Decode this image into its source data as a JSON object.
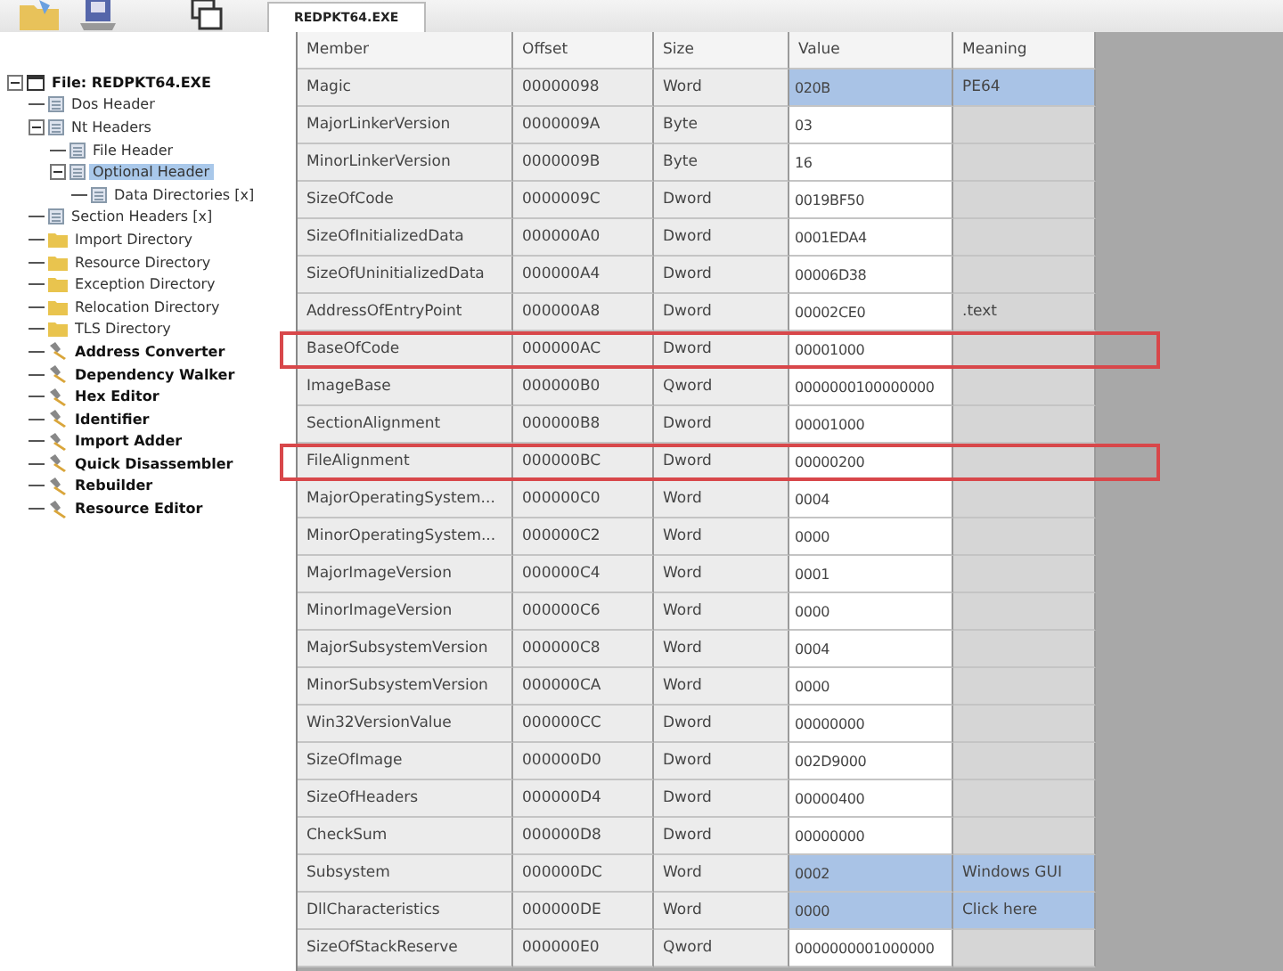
{
  "tab": {
    "label": "REDPKT64.EXE",
    "selected": true
  },
  "tree": [
    {
      "label": "File: REDPKT64.EXE",
      "kind": "file",
      "expanded": true,
      "selected": false,
      "children": [
        {
          "label": "Dos Header",
          "kind": "page",
          "selected": false
        },
        {
          "label": "Nt Headers",
          "kind": "page",
          "expanded": true,
          "selected": false,
          "children": [
            {
              "label": "File Header",
              "kind": "page",
              "selected": false
            },
            {
              "label": "Optional Header",
              "kind": "page",
              "expanded": true,
              "selected": true,
              "children": [
                {
                  "label": "Data Directories [x]",
                  "kind": "page",
                  "selected": false
                }
              ]
            }
          ]
        },
        {
          "label": "Section Headers [x]",
          "kind": "page",
          "selected": false
        },
        {
          "label": "Import Directory",
          "kind": "folder",
          "selected": false
        },
        {
          "label": "Resource Directory",
          "kind": "folder",
          "selected": false
        },
        {
          "label": "Exception Directory",
          "kind": "folder",
          "selected": false
        },
        {
          "label": "Relocation Directory",
          "kind": "folder",
          "selected": false
        },
        {
          "label": "TLS Directory",
          "kind": "folder",
          "selected": false
        },
        {
          "label": "Address Converter",
          "kind": "tool",
          "selected": false
        },
        {
          "label": "Dependency Walker",
          "kind": "tool",
          "selected": false
        },
        {
          "label": "Hex Editor",
          "kind": "tool",
          "selected": false
        },
        {
          "label": "Identifier",
          "kind": "tool",
          "selected": false
        },
        {
          "label": "Import Adder",
          "kind": "tool",
          "selected": false
        },
        {
          "label": "Quick Disassembler",
          "kind": "tool",
          "selected": false
        },
        {
          "label": "Rebuilder",
          "kind": "tool",
          "selected": false
        },
        {
          "label": "Resource Editor",
          "kind": "tool",
          "selected": false
        }
      ]
    }
  ],
  "table": {
    "columns": [
      "Member",
      "Offset",
      "Size",
      "Value",
      "Meaning"
    ],
    "rows": [
      {
        "cells": [
          "Magic",
          "00000098",
          "Word",
          "020B",
          "PE64"
        ],
        "selected": true,
        "highlighted": false
      },
      {
        "cells": [
          "MajorLinkerVersion",
          "0000009A",
          "Byte",
          "03",
          ""
        ],
        "selected": false,
        "highlighted": false
      },
      {
        "cells": [
          "MinorLinkerVersion",
          "0000009B",
          "Byte",
          "16",
          ""
        ],
        "selected": false,
        "highlighted": false
      },
      {
        "cells": [
          "SizeOfCode",
          "0000009C",
          "Dword",
          "0019BF50",
          ""
        ],
        "selected": false,
        "highlighted": false
      },
      {
        "cells": [
          "SizeOfInitializedData",
          "000000A0",
          "Dword",
          "0001EDA4",
          ""
        ],
        "selected": false,
        "highlighted": false
      },
      {
        "cells": [
          "SizeOfUninitializedData",
          "000000A4",
          "Dword",
          "00006D38",
          ""
        ],
        "selected": false,
        "highlighted": false
      },
      {
        "cells": [
          "AddressOfEntryPoint",
          "000000A8",
          "Dword",
          "00002CE0",
          ".text"
        ],
        "selected": false,
        "highlighted": false
      },
      {
        "cells": [
          "BaseOfCode",
          "000000AC",
          "Dword",
          "00001000",
          ""
        ],
        "selected": false,
        "highlighted": true
      },
      {
        "cells": [
          "ImageBase",
          "000000B0",
          "Qword",
          "0000000100000000",
          ""
        ],
        "selected": false,
        "highlighted": false
      },
      {
        "cells": [
          "SectionAlignment",
          "000000B8",
          "Dword",
          "00001000",
          ""
        ],
        "selected": false,
        "highlighted": false
      },
      {
        "cells": [
          "FileAlignment",
          "000000BC",
          "Dword",
          "00000200",
          ""
        ],
        "selected": false,
        "highlighted": true
      },
      {
        "cells": [
          "MajorOperatingSystem...",
          "000000C0",
          "Word",
          "0004",
          ""
        ],
        "selected": false,
        "highlighted": false
      },
      {
        "cells": [
          "MinorOperatingSystem...",
          "000000C2",
          "Word",
          "0000",
          ""
        ],
        "selected": false,
        "highlighted": false
      },
      {
        "cells": [
          "MajorImageVersion",
          "000000C4",
          "Word",
          "0001",
          ""
        ],
        "selected": false,
        "highlighted": false
      },
      {
        "cells": [
          "MinorImageVersion",
          "000000C6",
          "Word",
          "0000",
          ""
        ],
        "selected": false,
        "highlighted": false
      },
      {
        "cells": [
          "MajorSubsystemVersion",
          "000000C8",
          "Word",
          "0004",
          ""
        ],
        "selected": false,
        "highlighted": false
      },
      {
        "cells": [
          "MinorSubsystemVersion",
          "000000CA",
          "Word",
          "0000",
          ""
        ],
        "selected": false,
        "highlighted": false
      },
      {
        "cells": [
          "Win32VersionValue",
          "000000CC",
          "Dword",
          "00000000",
          ""
        ],
        "selected": false,
        "highlighted": false
      },
      {
        "cells": [
          "SizeOfImage",
          "000000D0",
          "Dword",
          "002D9000",
          ""
        ],
        "selected": false,
        "highlighted": false
      },
      {
        "cells": [
          "SizeOfHeaders",
          "000000D4",
          "Dword",
          "00000400",
          ""
        ],
        "selected": false,
        "highlighted": false
      },
      {
        "cells": [
          "CheckSum",
          "000000D8",
          "Dword",
          "00000000",
          ""
        ],
        "selected": false,
        "highlighted": false
      },
      {
        "cells": [
          "Subsystem",
          "000000DC",
          "Word",
          "0002",
          "Windows GUI"
        ],
        "selected": true,
        "highlighted": false
      },
      {
        "cells": [
          "DllCharacteristics",
          "000000DE",
          "Word",
          "0000",
          "Click here"
        ],
        "selected": true,
        "highlighted": false
      },
      {
        "cells": [
          "SizeOfStackReserve",
          "000000E0",
          "Qword",
          "0000000001000000",
          ""
        ],
        "selected": false,
        "highlighted": false
      }
    ]
  }
}
